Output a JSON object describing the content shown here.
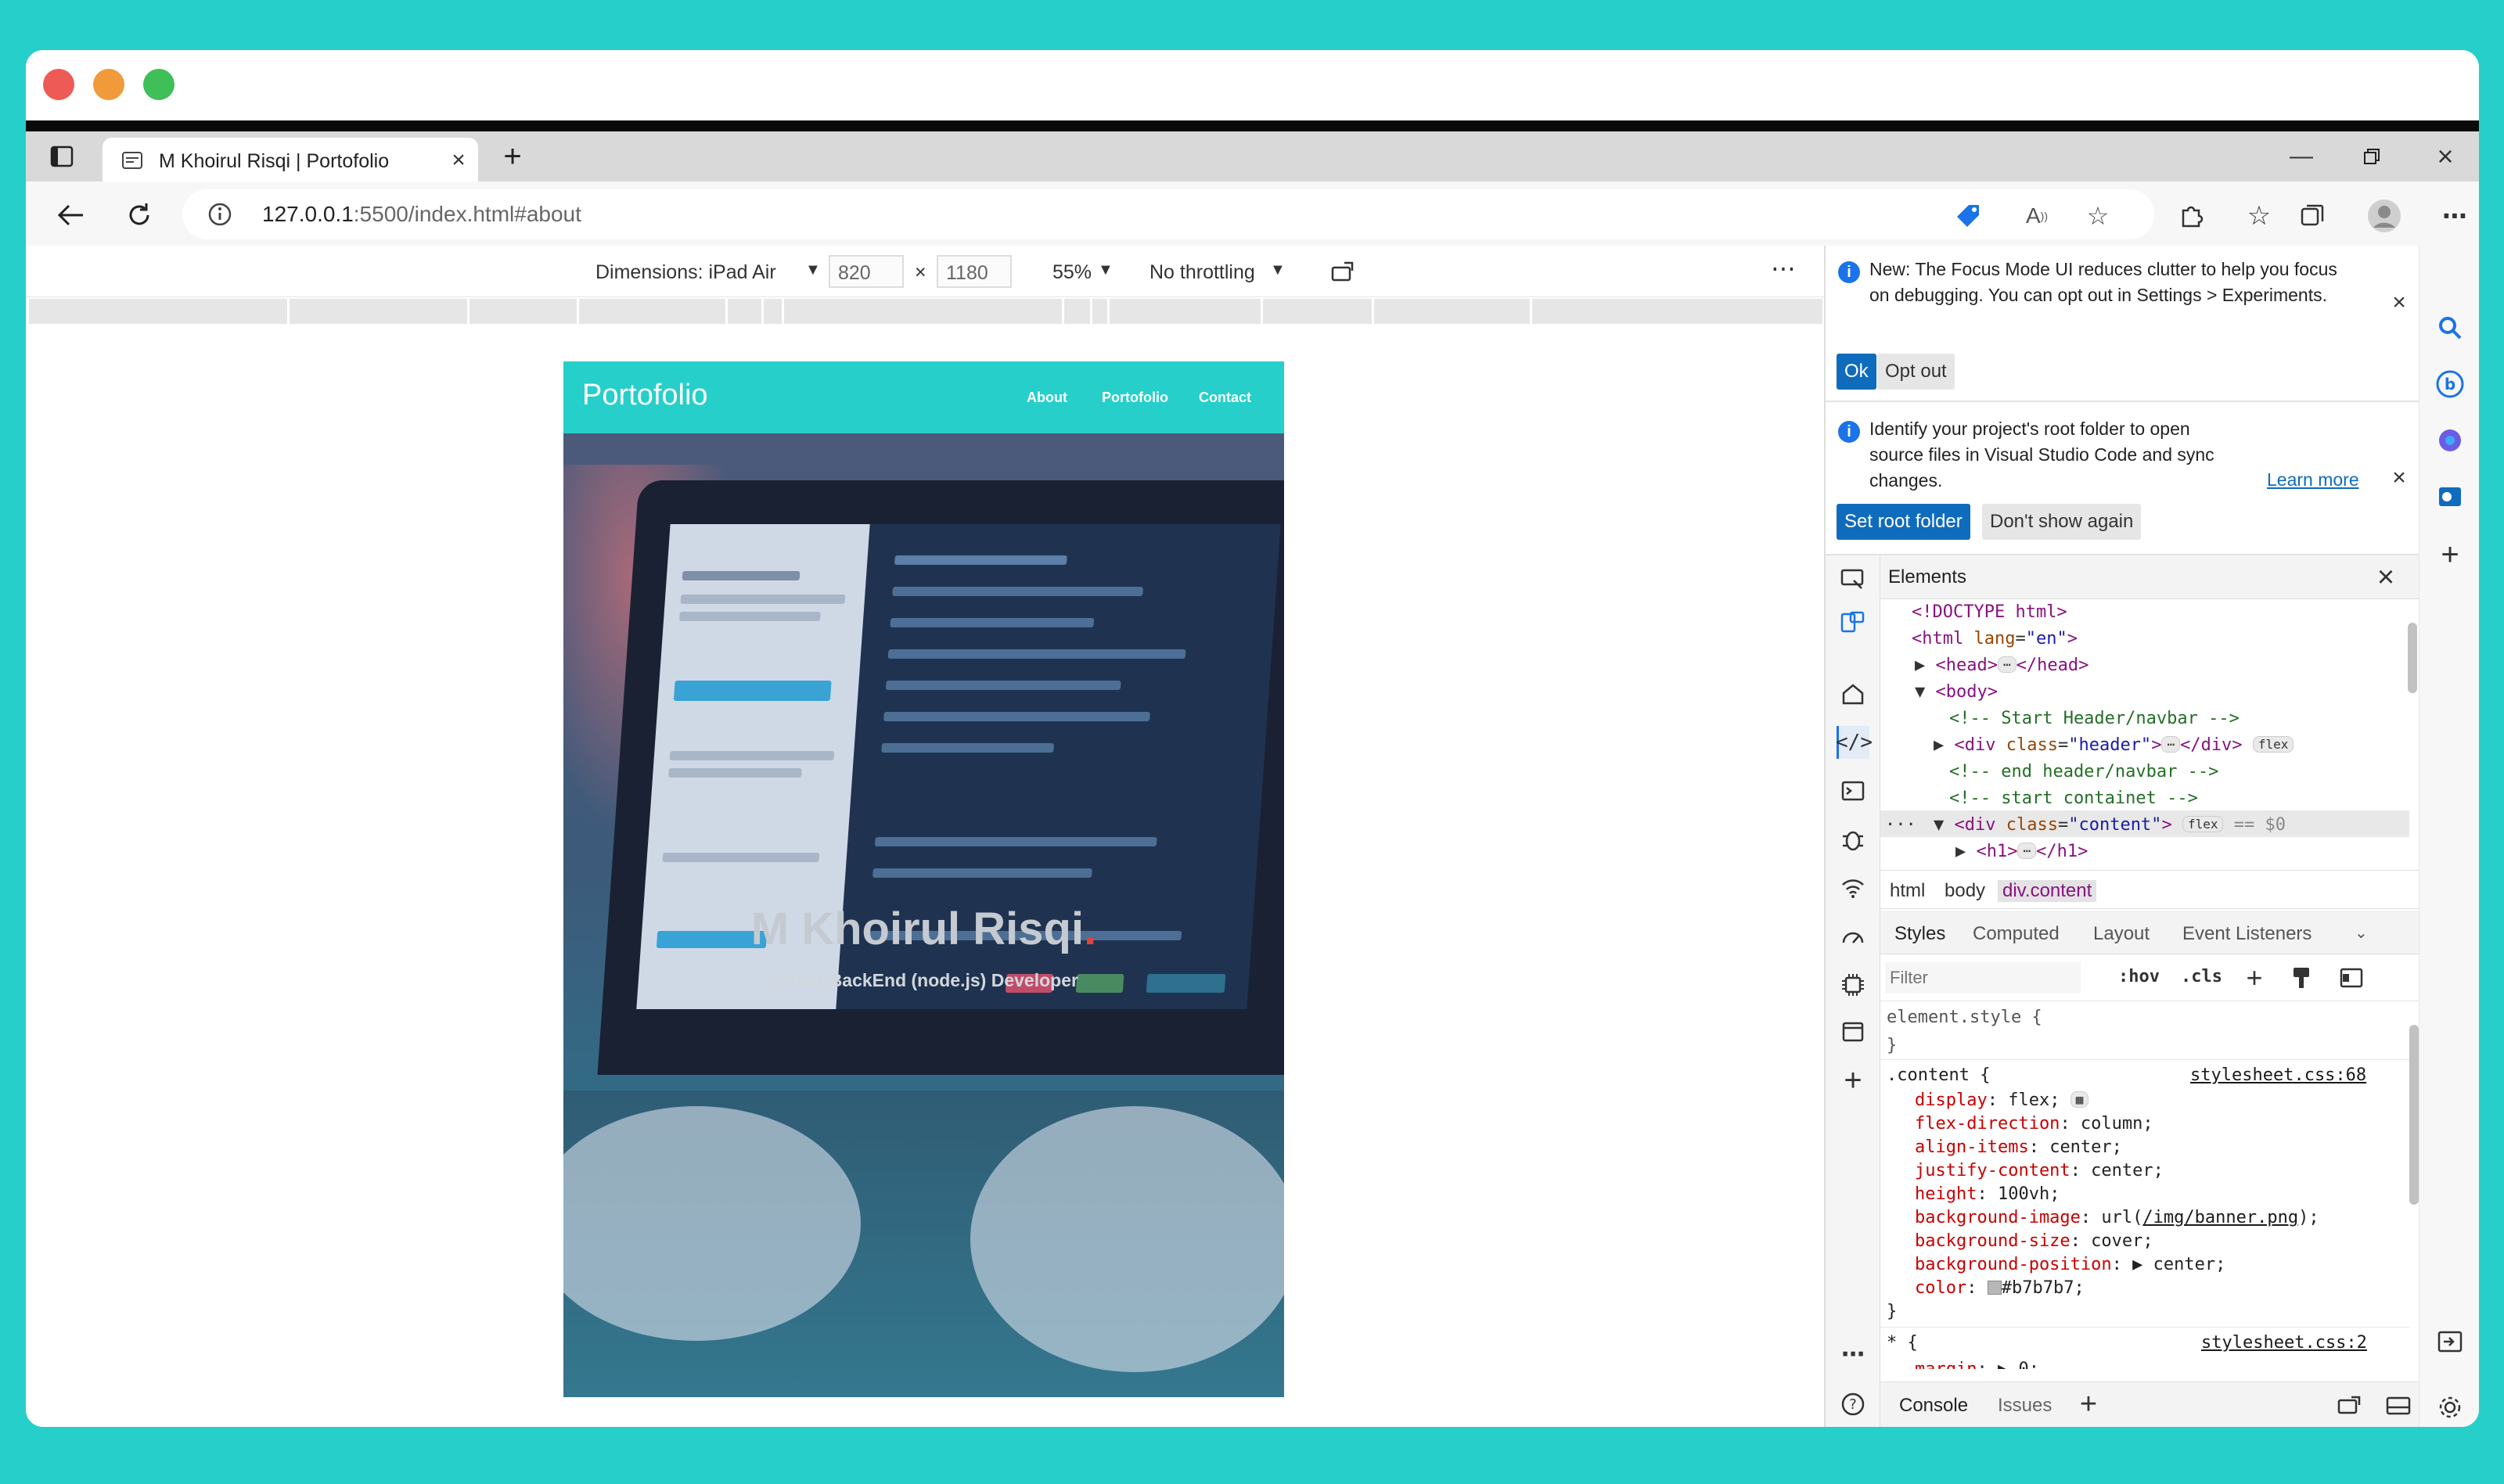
{
  "tab": {
    "title": "M Khoirul Risqi | Portofolio"
  },
  "address": {
    "host": "127.0.0.1",
    "rest": ":5500/index.html#about"
  },
  "device_toolbar": {
    "dimensions_label": "Dimensions: iPad Air",
    "width": "820",
    "times": "×",
    "height": "1180",
    "zoom": "55%",
    "throttling": "No throttling",
    "more": "⋯"
  },
  "site": {
    "logo": "Portofolio",
    "nav": [
      "About",
      "Portofolio",
      "Contact"
    ],
    "hero_name": "M Khoirul Risqi",
    "hero_dot": ".",
    "hero_subtitle": "Junior BackEnd (node.js) Developer"
  },
  "devtools": {
    "notice1": {
      "line1": "New: The Focus Mode UI reduces clutter to help you focus",
      "line2": "on debugging. You can opt out in Settings > Experiments.",
      "ok": "Ok",
      "opt_out": "Opt out"
    },
    "notice2": {
      "line1": "Identify your project's root folder to open",
      "line2": "source files in Visual Studio Code and sync",
      "line3": "changes.",
      "learn_more": "Learn more",
      "set_root": "Set root folder",
      "dont_show": "Don't show again"
    },
    "elements_title": "Elements",
    "breadcrumbs": [
      "html",
      "body",
      "div.content"
    ],
    "style_tabs": [
      "Styles",
      "Computed",
      "Layout",
      "Event Listeners"
    ],
    "filter_placeholder": "Filter",
    "hov": ":hov",
    "cls": ".cls",
    "console_tabs": [
      "Console",
      "Issues"
    ],
    "dots": "···"
  },
  "colors": {
    "brand": "#26cfc9",
    "accent": "#0f6cbd"
  }
}
